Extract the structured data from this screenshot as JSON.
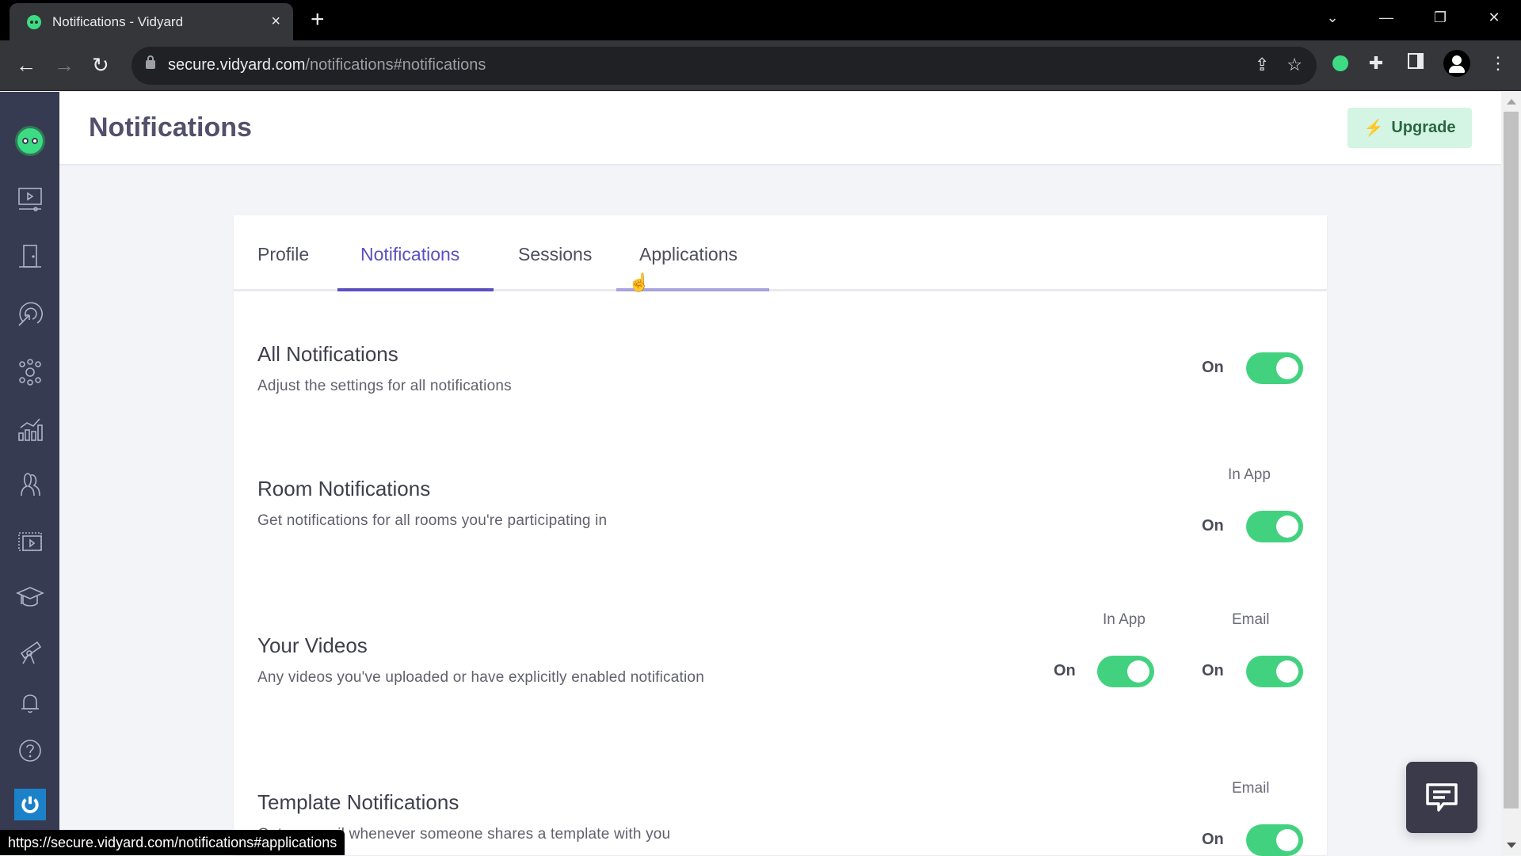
{
  "browser": {
    "tab_title": "Notifications - Vidyard",
    "url_host": "secure.vidyard.com",
    "url_path": "/notifications#notifications",
    "status_url": "https://secure.vidyard.com/notifications#applications",
    "icons": {
      "close": "×",
      "new_tab": "+",
      "back": "←",
      "forward": "→",
      "reload": "↻",
      "share": "⇪",
      "star": "☆",
      "puzzle": "✚",
      "menu": "⋮",
      "tab_search": "⌄",
      "minimize": "—",
      "restore": "❐",
      "win_close": "✕"
    }
  },
  "sidebar": {
    "items": [
      {
        "name": "vidyard-logo"
      },
      {
        "name": "videos"
      },
      {
        "name": "rooms"
      },
      {
        "name": "prospecting"
      },
      {
        "name": "integrations"
      },
      {
        "name": "analytics"
      },
      {
        "name": "team"
      },
      {
        "name": "library"
      },
      {
        "name": "training"
      },
      {
        "name": "discover"
      },
      {
        "name": "notifications"
      },
      {
        "name": "help"
      },
      {
        "name": "power"
      }
    ]
  },
  "header": {
    "title": "Notifications",
    "upgrade_label": "Upgrade",
    "upgrade_icon": "⚡"
  },
  "tabs": [
    {
      "label": "Profile",
      "active": false
    },
    {
      "label": "Notifications",
      "active": true
    },
    {
      "label": "Sessions",
      "active": false
    },
    {
      "label": "Applications",
      "active": false,
      "hover": true
    }
  ],
  "colors": {
    "accent": "#5b4fc2",
    "toggle_on": "#42d27f",
    "sidebar_bg": "#363b52",
    "upgrade_bg": "#d4f5e3"
  },
  "sections": [
    {
      "title": "All Notifications",
      "description": "Adjust the settings for all notifications",
      "toggles": [
        {
          "column": "",
          "state_label": "On",
          "on": true
        }
      ]
    },
    {
      "title": "Room Notifications",
      "description": "Get notifications for all rooms you're participating in",
      "toggles": [
        {
          "column": "In App",
          "state_label": "On",
          "on": true
        }
      ]
    },
    {
      "title": "Your Videos",
      "description": "Any videos you've uploaded or have explicitly enabled notification",
      "toggles": [
        {
          "column": "In App",
          "state_label": "On",
          "on": true
        },
        {
          "column": "Email",
          "state_label": "On",
          "on": true
        }
      ]
    },
    {
      "title": "Template Notifications",
      "description": "Get an email whenever someone shares a template with you",
      "toggles": [
        {
          "column": "Email",
          "state_label": "On",
          "on": true
        }
      ]
    }
  ]
}
